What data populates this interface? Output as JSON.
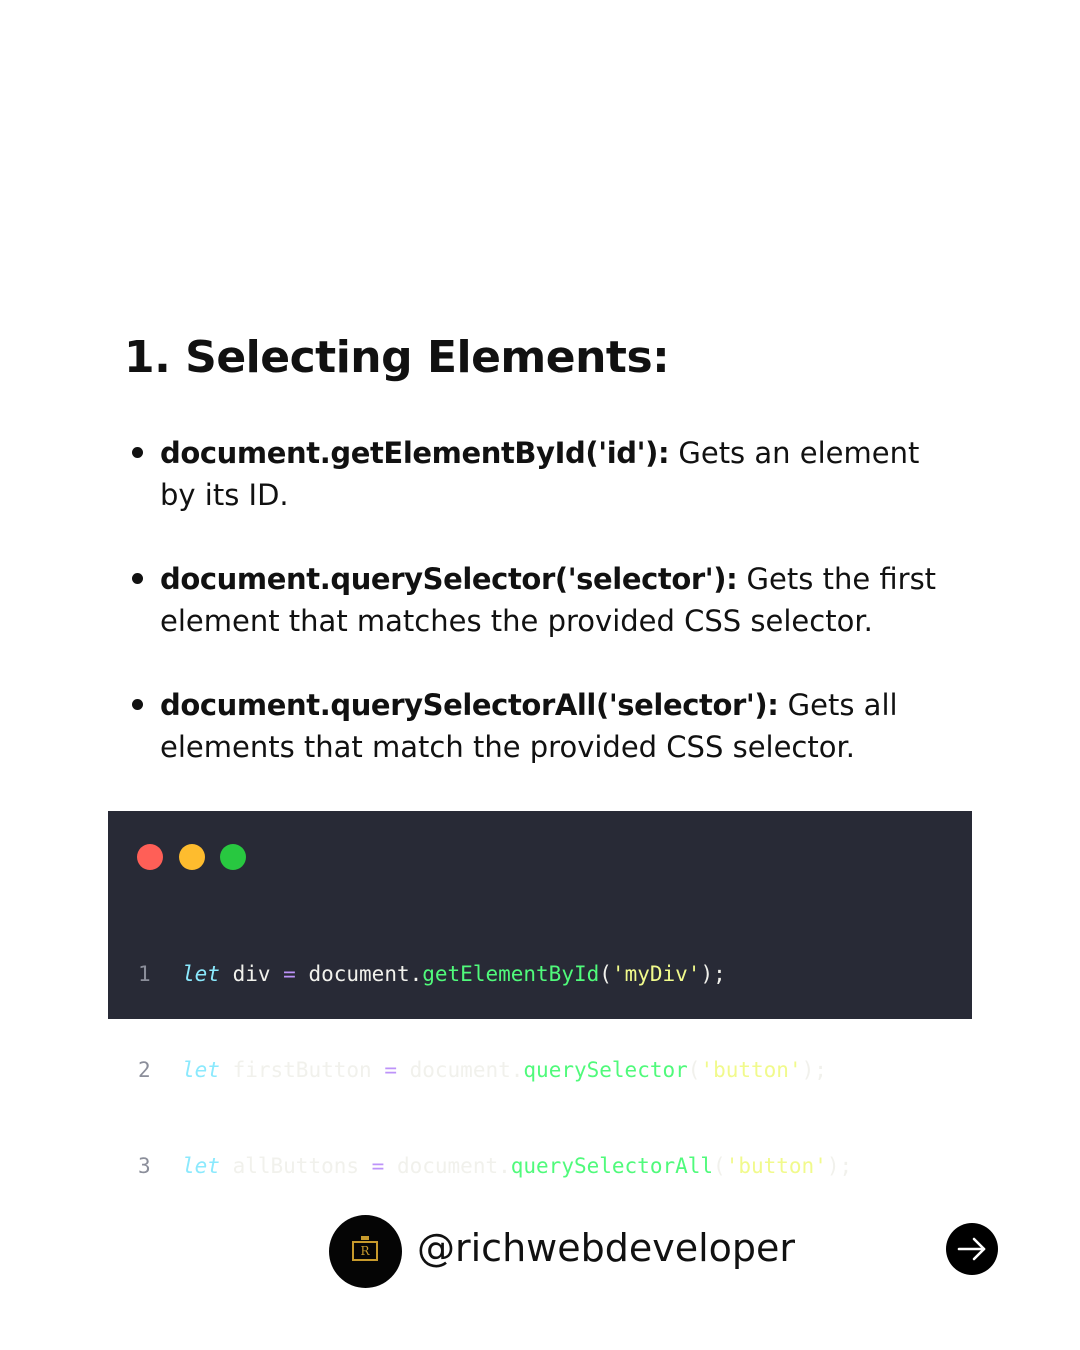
{
  "heading": "1. Selecting Elements:",
  "bullets": [
    {
      "term": "document.getElementById('id'):",
      "description": " Gets an element by its ID."
    },
    {
      "term": "document.querySelector('selector'):",
      "description": " Gets the first element that matches the provided CSS selector."
    },
    {
      "term": "document.querySelectorAll('selector'):",
      "description": " Gets all elements that match the provided CSS selector."
    }
  ],
  "code": {
    "colors": {
      "background": "#282a36",
      "keyword": "#8be9fd",
      "function": "#50fa7b",
      "string": "#f1fa8c",
      "operator": "#bd93f9",
      "traffic_red": "#ff5f57",
      "traffic_yellow": "#febc2e",
      "traffic_green": "#28c840"
    },
    "lines": [
      {
        "number": "1",
        "keyword": "let",
        "variable": " div ",
        "operator": "=",
        "object": " document.",
        "method": "getElementById",
        "open": "(",
        "argument": "'myDiv'",
        "close": ");"
      },
      {
        "number": "2",
        "keyword": "let",
        "variable": " firstButton ",
        "operator": "=",
        "object": " document.",
        "method": "querySelector",
        "open": "(",
        "argument": "'button'",
        "close": ");"
      },
      {
        "number": "3",
        "keyword": "let",
        "variable": " allButtons ",
        "operator": "=",
        "object": " document.",
        "method": "querySelectorAll",
        "open": "(",
        "argument": "'button'",
        "close": ");"
      }
    ]
  },
  "footer": {
    "avatar_icon": "richwebdeveloper-logo-icon",
    "avatar_letter": "R",
    "handle": "@richwebdeveloper",
    "next_icon": "arrow-right-icon"
  }
}
